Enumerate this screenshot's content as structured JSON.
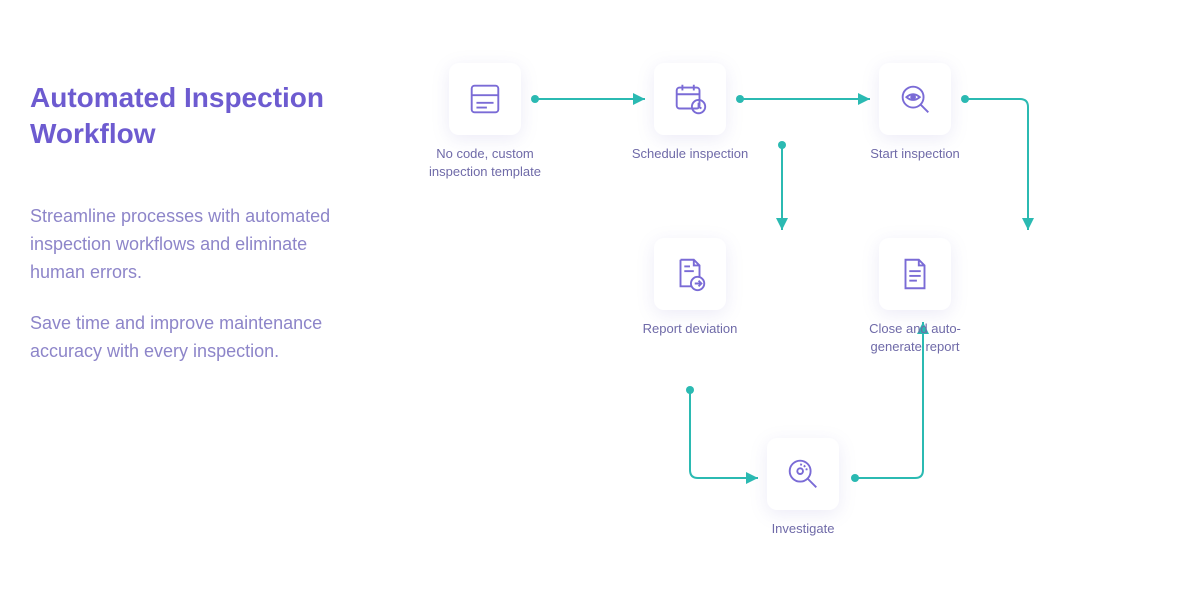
{
  "heading": "Automated Inspection Workflow",
  "paragraphs": [
    "Streamline processes with automated inspection workflows and eliminate human errors.",
    "Save time and improve maintenance accuracy with every inspection."
  ],
  "nodes": {
    "n1": {
      "label": "No code, custom inspection template",
      "icon": "template-icon"
    },
    "n2": {
      "label": "Schedule inspection",
      "icon": "calendar-clock-icon"
    },
    "n3": {
      "label": "Start inspection",
      "icon": "eye-magnifier-icon"
    },
    "n4": {
      "label": "Report deviation",
      "icon": "document-arrow-icon"
    },
    "n5": {
      "label": "Close and auto-generate report",
      "icon": "document-lines-icon"
    },
    "n6": {
      "label": "Investigate",
      "icon": "investigate-magnifier-icon"
    }
  },
  "colors": {
    "purple": "#7a6bd6",
    "teal": "#2bbab2",
    "text": "#6f6aa8"
  },
  "connectors": [
    {
      "from": "n1",
      "to": "n2",
      "path": "right"
    },
    {
      "from": "n2",
      "to": "n3",
      "path": "right"
    },
    {
      "from": "n2",
      "to": "n4",
      "path": "down-right-then-down"
    },
    {
      "from": "n3",
      "to": "n5",
      "path": "right-then-down"
    },
    {
      "from": "n4",
      "to": "n6",
      "path": "down-then-right"
    },
    {
      "from": "n6",
      "to": "n5",
      "path": "right-then-up"
    }
  ]
}
